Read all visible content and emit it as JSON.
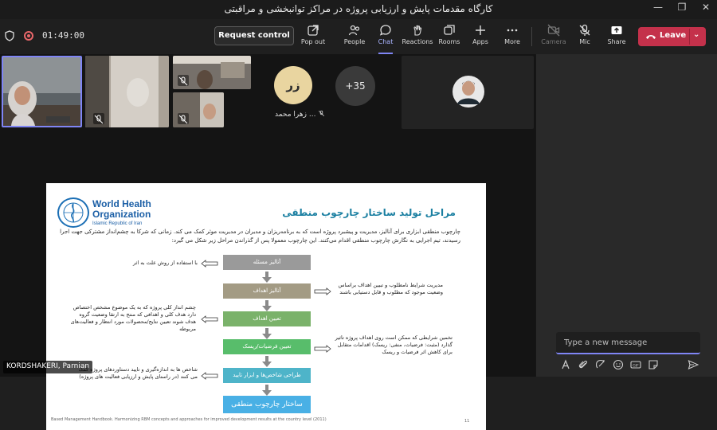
{
  "window": {
    "title": "کارگاه مقدمات پایش و ارزیابی پروژه در مراکز توانبخشی و مراقبتی",
    "minimize": "—",
    "restore": "❐",
    "close": "✕"
  },
  "toolbar": {
    "timer": "01:49:00",
    "request_control": "Request control",
    "items": [
      {
        "label": "Pop out",
        "icon": "pop-out-icon"
      },
      {
        "label": "People",
        "icon": "people-icon"
      },
      {
        "label": "Chat",
        "icon": "chat-icon",
        "active": true
      },
      {
        "label": "Reactions",
        "icon": "reactions-icon"
      },
      {
        "label": "Rooms",
        "icon": "rooms-icon"
      },
      {
        "label": "Apps",
        "icon": "apps-icon"
      },
      {
        "label": "More",
        "icon": "more-icon"
      },
      {
        "label": "Camera",
        "icon": "camera-off-icon",
        "disabled": true
      },
      {
        "label": "Mic",
        "icon": "mic-off-icon"
      },
      {
        "label": "Share",
        "icon": "share-icon"
      }
    ],
    "leave": "Leave"
  },
  "participants": {
    "avatar_initials": "زر",
    "avatar_name": "زهرا محمد ...",
    "overflow_count": "+35",
    "presenter_name": "KORDSHAKERI, Parnian"
  },
  "slide": {
    "org_name_line1": "World Health",
    "org_name_line2": "Organization",
    "org_region": "Islamic Republic of Iran",
    "title": "مراحل تولید ساختار چارچوب منطقی",
    "paragraph": "چارچوب منطقی ابزاری برای آنالیز، مدیریت و پیشبرد پروژه است که به برنامه‌ریزان و مدیران در مدیریت موثر کمک می کند. زمانی که شرکا به چشم‌انداز مشترکی جهت اجرا رسیدند، تیم اجرایی به نگارش چارچوب منطقی اقدام می‌کنند. این چارچوب معمولا پس از گذراندن مراحل زیر شکل می گیرد:",
    "steps": [
      {
        "label": "آنالیز مسئله",
        "color": "#9a9a9a"
      },
      {
        "label": "آنالیز اهداف",
        "color": "#a39b84"
      },
      {
        "label": "تعیین اهداف",
        "color": "#7ab26a"
      },
      {
        "label": "تعیین فرضیات/ریسک",
        "color": "#58bd6b"
      },
      {
        "label": "طراحی شاخص‌ها و ابزار تایید",
        "color": "#4eb4c9"
      },
      {
        "label": "ساختار چارچوب منطقی",
        "color": "#49b0e5"
      }
    ],
    "notes": {
      "problem": "با استفاده از روش علت به اثر",
      "objectives": "مدیریت شرایط نامطلوب و تبیین اهداف براساس وضعیت موجود که مطلوب و قابل دستیابی باشند",
      "goals": "چشم انداز کلی پروژه که به یک موضوع مشخص اختصاص دارد هدف کلی و اهدافی که منتج به ارتقا وضعیت گروه هدف شوند تعیین نتایج/محصولات مورد انتظار و فعالیت‌های مربوطه",
      "assumptions": "تخمین شرایطی که ممکن است روی اهداف پروژه تاثیر گذارد (مثبت: فرضیات، منفی: ریسک) اقدامات متقابل برای کاهش اثر فرضیات و ریسک",
      "indicators": "شاخص ها به اندازه‌گیری و تایید دستاوردهای پروژه کمک می کنند (در راستای پایش و ارزیابی فعالیت های پروژه)"
    },
    "footnote": "Based Management Handbook. Harmonizing RBM concepts and approaches for improved development results at the country level (2011)",
    "page_number": "11"
  },
  "chat": {
    "placeholder": "Type a new message",
    "tools": [
      "format-icon",
      "attach-icon",
      "loop-icon",
      "emoji-icon",
      "gif-icon",
      "sticker-icon",
      "send-icon"
    ]
  },
  "colors": {
    "accent": "#7f85f5",
    "leave": "#c4314b",
    "who_blue": "#1b5fa6",
    "slide_title": "#1a7fa1"
  }
}
